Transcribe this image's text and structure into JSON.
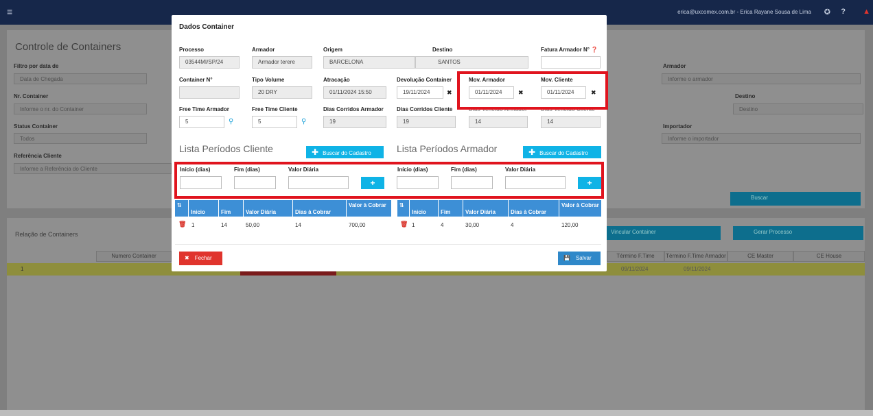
{
  "topbar": {
    "user": "erica@uxcomex.com.br - Erica Rayane Sousa de Lima",
    "menu_icon": "hamburger-icon"
  },
  "background": {
    "page_title": "Controle de Containers",
    "filters": [
      {
        "label": "Filtro por data de",
        "value": "Data de Chegada"
      },
      {
        "label": "Nr. Container",
        "value": "Informe o nr. do Container"
      },
      {
        "label": "Status Container",
        "value": "Todos"
      },
      {
        "label": "Referência Cliente",
        "value": "Informe a Referência do Cliente"
      },
      {
        "label": "Armador",
        "value": "Informe o armador"
      },
      {
        "label": "Destino",
        "value": "Destino"
      },
      {
        "label": "Importador",
        "value": "Informe o importador"
      }
    ],
    "buscar": "Buscar",
    "relacao": "Relação de Containers",
    "vincular": "Vincular Container",
    "gerar": "Gerar Processo",
    "grid_cols": [
      "Numero Container",
      "Término F.Time Cliente",
      "Término F.Time Armador",
      "CE Master",
      "CE House"
    ],
    "grid_row": {
      "num": "1",
      "cliente": "09/11/2024",
      "armador": "09/11/2024"
    }
  },
  "modal": {
    "title": "Dados Container",
    "labels": {
      "processo": "Processo",
      "armador": "Armador",
      "origem": "Origem",
      "destino": "Destino",
      "fatura": "Fatura Armador N°",
      "container": "Container N°",
      "tipo": "Tipo Volume",
      "atracacao": "Atracação",
      "devolucao": "Devolução Container",
      "mov_armador": "Mov. Armador",
      "mov_cliente": "Mov. Cliente",
      "ft_armador": "Free Time Armador",
      "ft_cliente": "Free Time Cliente",
      "dc_armador": "Dias Corridos Armador",
      "dc_cliente": "Dias Corridos Cliente",
      "dv_armador": "Dias Vencido Armador",
      "dv_cliente": "Dias Vencido Cliente"
    },
    "values": {
      "processo": "03544MI/SP/24",
      "armador": "Armador terere",
      "origem": "BARCELONA",
      "destino": "SANTOS",
      "fatura": "",
      "container": "",
      "tipo": "20 DRY",
      "atracacao": "01/11/2024 15:50",
      "devolucao": "19/11/2024",
      "mov_armador": "01/11/2024",
      "mov_cliente": "01/11/2024",
      "ft_armador": "5",
      "ft_cliente": "5",
      "dc_armador": "19",
      "dc_cliente": "19",
      "dv_armador": "14",
      "dv_cliente": "14"
    },
    "lista_cliente": "Lista Períodos Cliente",
    "lista_armador": "Lista Períodos Armador",
    "buscar_cadastro": "Buscar do Cadastro",
    "inicio": "Início (dias)",
    "fim": "Fim (dias)",
    "valor": "Valor Diária",
    "add": "+",
    "table_headers": [
      "Inicio",
      "Fim",
      "Valor Diária",
      "Dias à Cobrar",
      "Valor à Cobrar"
    ],
    "row_cliente": [
      "1",
      "14",
      "50,00",
      "14",
      "700,00"
    ],
    "row_armador": [
      "1",
      "4",
      "30,00",
      "4",
      "120,00"
    ],
    "fechar": "Fechar",
    "salvar": "Salvar"
  },
  "colors": {
    "accent": "#0fb3e6",
    "table_header": "#3d8fd6",
    "highlight": "#e0141e",
    "danger": "#e0342d"
  }
}
